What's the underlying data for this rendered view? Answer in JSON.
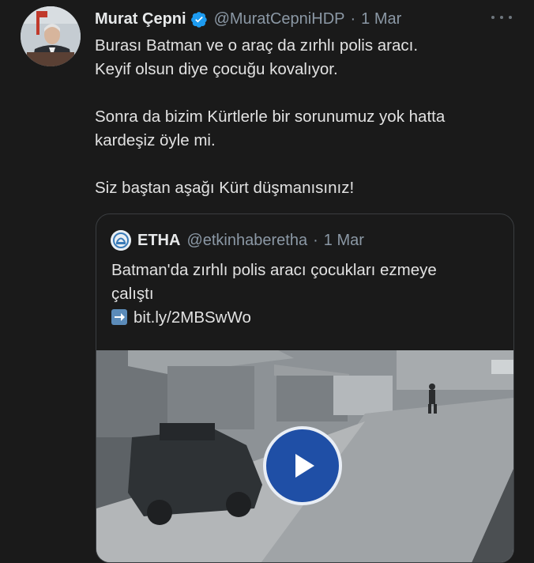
{
  "tweet": {
    "author_name": "Murat Çepni",
    "handle": "@MuratCepniHDP",
    "separator": "·",
    "date": "1 Mar",
    "lines": [
      "Burası Batman ve o araç da zırhlı polis aracı.",
      "Keyif olsun diye çocuğu kovalıyor.",
      "",
      "Sonra da bizim Kürtlerle bir sorunumuz yok hatta",
      "kardeşiz öyle mi.",
      "",
      "Siz baştan aşağı Kürt düşmanısınız!"
    ]
  },
  "quote": {
    "author_name": "ETHA",
    "handle": "@etkinhaberetha",
    "separator": "·",
    "date": "1 Mar",
    "text_line1": "Batman'da zırhlı polis aracı çocukları ezmeye",
    "text_line2": "çalıştı",
    "link": "bit.ly/2MBSwWo"
  },
  "icons": {
    "verified": "verified-badge-icon",
    "more": "more-options-icon",
    "play": "play-icon",
    "link_arrow": "right-arrow-emoji-icon"
  },
  "colors": {
    "background": "#1a1a1a",
    "verified_blue": "#1d9bf0",
    "play_button": "#1f4fa6",
    "muted_text": "#8b98a5"
  }
}
